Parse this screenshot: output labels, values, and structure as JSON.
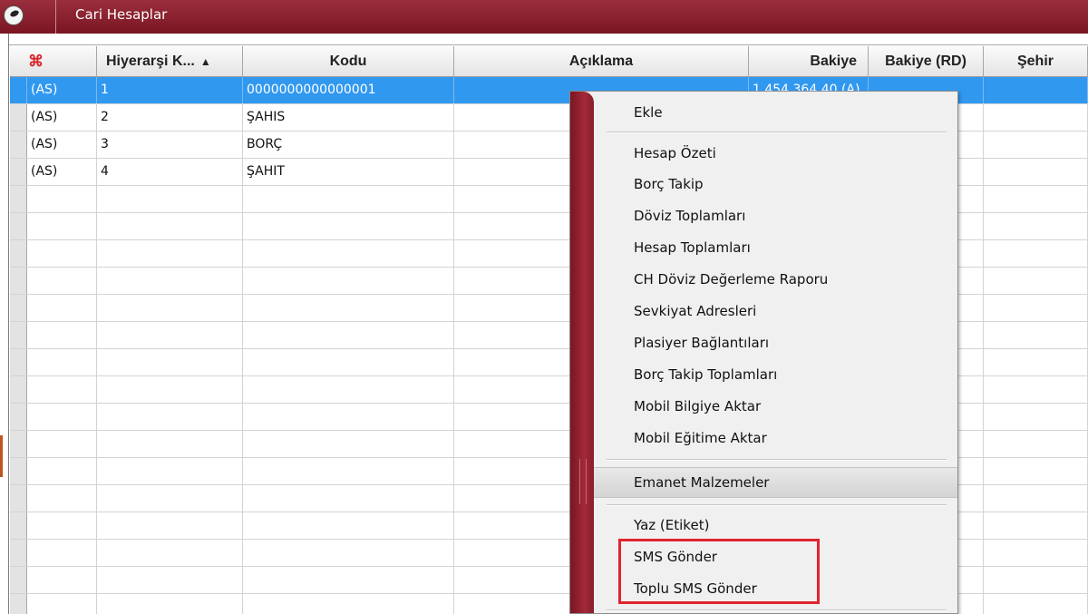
{
  "window": {
    "title": "Cari Hesaplar"
  },
  "columns": {
    "hierarchy": "Hiyerarşi K...",
    "code": "Kodu",
    "description": "Açıklama",
    "balance": "Bakiye",
    "balance_rd": "Bakiye (RD)",
    "city": "Şehir"
  },
  "rows": [
    {
      "tag": "(AS)",
      "hier": "1",
      "code": "0000000000000001",
      "balance": "1.454.364,40 (A)"
    },
    {
      "tag": "(AS)",
      "hier": "2",
      "code": "ŞAHIS",
      "balance": ""
    },
    {
      "tag": "(AS)",
      "hier": "3",
      "code": "BORÇ",
      "balance": ""
    },
    {
      "tag": "(AS)",
      "hier": "4",
      "code": "ŞAHIT",
      "balance": ""
    }
  ],
  "context_menu": {
    "items": [
      "Ekle",
      "Hesap Özeti",
      "Borç Takip",
      "Döviz Toplamları",
      "Hesap Toplamları",
      "CH Döviz Değerleme Raporu",
      "Sevkiyat Adresleri",
      "Plasiyer Bağlantıları",
      "Borç Takip Toplamları",
      "Mobil Bilgiye Aktar",
      "Mobil Eğitime Aktar",
      "Emanet Malzemeler",
      "Yaz (Etiket)",
      "SMS Gönder",
      "Toplu SMS Gönder"
    ]
  },
  "colors": {
    "title_bar": "#8a1f2d",
    "selection": "#3198f0",
    "highlight_box": "#e0252e"
  }
}
